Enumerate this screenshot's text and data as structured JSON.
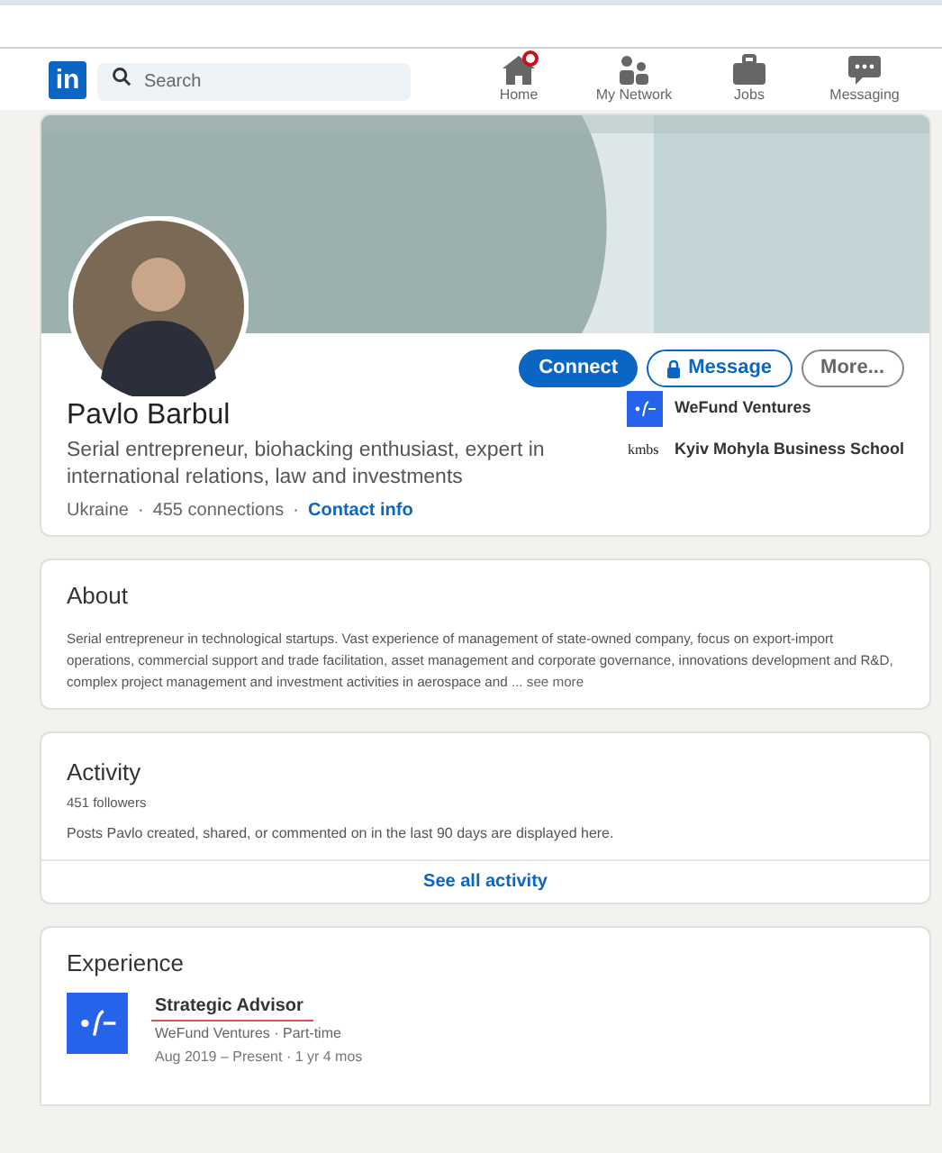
{
  "nav": {
    "logo": "in",
    "search": {
      "placeholder": "Search"
    },
    "items": [
      {
        "label": "Home",
        "kind": "home",
        "badge": true
      },
      {
        "label": "My Network",
        "kind": "network",
        "badge": false
      },
      {
        "label": "Jobs",
        "kind": "jobs",
        "badge": false
      },
      {
        "label": "Messaging",
        "kind": "messaging",
        "badge": false
      }
    ]
  },
  "profile": {
    "name": "Pavlo Barbul",
    "headline": "Serial entrepreneur, biohacking enthusiast, expert in international relations, law and investments",
    "location": "Ukraine",
    "separator": "·",
    "connections": "455 connections",
    "contact": "Contact info",
    "actions": [
      {
        "label": "Connect",
        "kind": "primary"
      },
      {
        "label": "Message",
        "kind": "locked"
      },
      {
        "label": "More...",
        "kind": "plain"
      }
    ],
    "orgs": [
      {
        "name": "WeFund Ventures",
        "kind": "wefund"
      },
      {
        "name": "Kyiv Mohyla Business School",
        "kind": "kmbs",
        "logo_text": "kmbs"
      }
    ]
  },
  "about": {
    "title": "About",
    "text": "Serial entrepreneur in technological startups. Vast experience of management of state-owned company, focus on export-import operations, commercial support and trade facilitation, asset management and corporate governance, innovations development and R&D, complex project management and investment activities in aerospace and",
    "more": "... see more"
  },
  "activity": {
    "title": "Activity",
    "followers": "451 followers",
    "text": "Posts Pavlo created, shared, or commented on in the last 90 days are displayed here.",
    "link": "See all activity"
  },
  "experience": {
    "title": "Experience",
    "items": [
      {
        "role": "Strategic Advisor",
        "company": "WeFund Ventures · Part-time",
        "dates": "Aug 2019 – Present · 1 yr 4 mos",
        "underlined": true
      }
    ]
  }
}
